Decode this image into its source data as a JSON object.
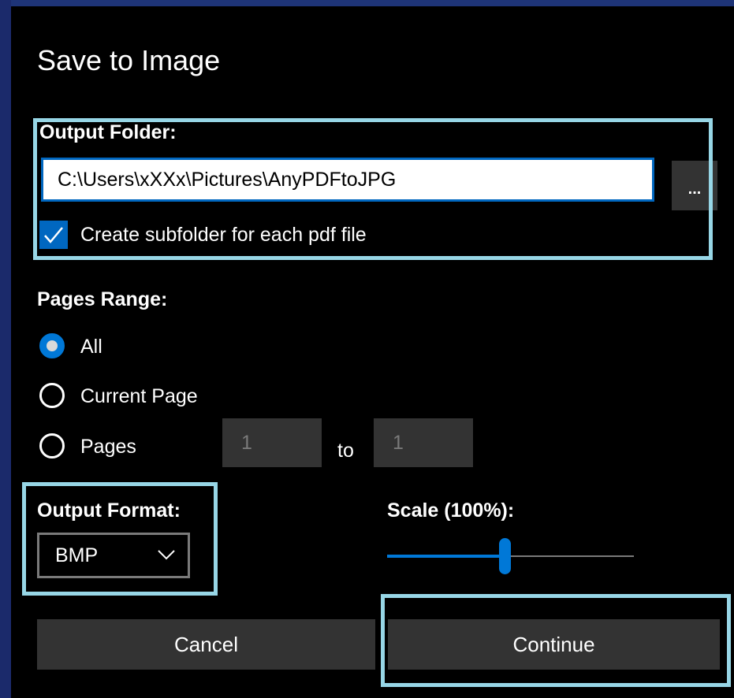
{
  "dialog": {
    "title": "Save to Image"
  },
  "output_folder": {
    "label": "Output Folder:",
    "path_value": "C:\\Users\\xXXx\\Pictures\\AnyPDFtoJPG",
    "browse_label": "...",
    "subfolder_checkbox_label": "Create subfolder for each pdf file",
    "subfolder_checked": true
  },
  "pages_range": {
    "label": "Pages Range:",
    "options": [
      {
        "label": "All",
        "selected": true
      },
      {
        "label": "Current Page",
        "selected": false
      },
      {
        "label": "Pages",
        "selected": false
      }
    ],
    "from_value": "1",
    "to_label": "to",
    "to_value": "1"
  },
  "output_format": {
    "label": "Output Format:",
    "selected": "BMP"
  },
  "scale": {
    "label": "Scale (100%):",
    "value_percent": 100
  },
  "buttons": {
    "cancel": "Cancel",
    "continue": "Continue"
  },
  "colors": {
    "accent": "#0078d7",
    "highlight": "#97d6e6",
    "background": "#000000"
  }
}
